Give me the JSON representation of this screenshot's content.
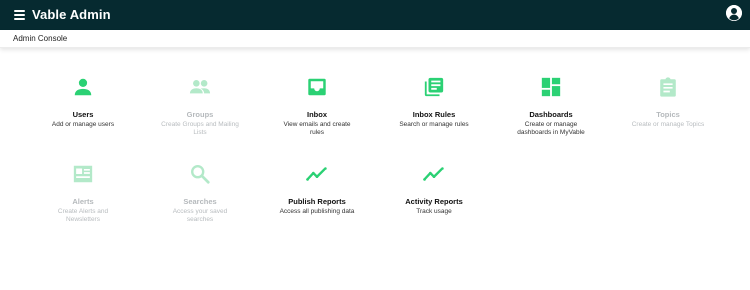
{
  "app": {
    "title": "Vable Admin",
    "subtitle": "Admin Console"
  },
  "colors": {
    "topbar": "#062a30",
    "accent": "#2bd174",
    "accent_disabled": "#b3e9c9"
  },
  "tiles": [
    {
      "label": "Users",
      "description": "Add or manage users",
      "icon": "person-icon",
      "disabled": false
    },
    {
      "label": "Groups",
      "description": "Create Groups and Mailing Lists",
      "icon": "group-icon",
      "disabled": true
    },
    {
      "label": "Inbox",
      "description": "View emails and create rules",
      "icon": "inbox-icon",
      "disabled": false
    },
    {
      "label": "Inbox Rules",
      "description": "Search or manage rules",
      "icon": "library-books-icon",
      "disabled": false
    },
    {
      "label": "Dashboards",
      "description": "Create or manage dashboards in MyVable",
      "icon": "dashboard-icon",
      "disabled": false
    },
    {
      "label": "Topics",
      "description": "Create or manage Topics",
      "icon": "clipboard-icon",
      "disabled": true
    },
    {
      "label": "Alerts",
      "description": "Create Alerts and Newsletters",
      "icon": "featured-article-icon",
      "disabled": true
    },
    {
      "label": "Searches",
      "description": "Access your saved searches",
      "icon": "search-icon",
      "disabled": true
    },
    {
      "label": "Publish Reports",
      "description": "Access all publishing data",
      "icon": "trending-line-icon",
      "disabled": false
    },
    {
      "label": "Activity Reports",
      "description": "Track usage",
      "icon": "trending-line-icon",
      "disabled": false
    }
  ]
}
